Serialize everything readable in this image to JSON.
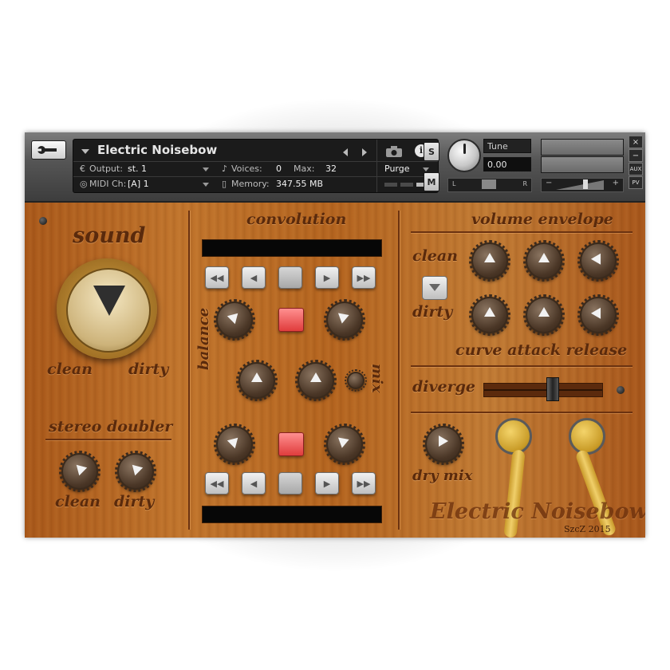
{
  "header": {
    "instrument_name": "Electric Noisebow",
    "output_label": "Output:",
    "output_value": "st. 1",
    "midi_label": "MIDI Ch:",
    "midi_value": "[A] 1",
    "voices_label": "Voices:",
    "voices_value": "0",
    "max_label": "Max:",
    "max_value": "32",
    "memory_label": "Memory:",
    "memory_value": "347.55 MB",
    "purge_label": "Purge",
    "solo_label": "S",
    "mute_label": "M",
    "tune_label": "Tune",
    "tune_value": "0.00",
    "pan_left": "L",
    "pan_right": "R",
    "vol_minus": "−",
    "vol_plus": "+",
    "side_close": "×",
    "side_min": "−",
    "side_aux": "AUX",
    "side_pv": "PV"
  },
  "panel": {
    "sound": {
      "title": "sound",
      "left": "clean",
      "right": "dirty"
    },
    "stereo_doubler": {
      "title": "stereo doubler",
      "left": "clean",
      "right": "dirty"
    },
    "convolution": {
      "title": "convolution",
      "balance": "balance",
      "mix": "mix"
    },
    "volume_envelope": {
      "title": "volume envelope",
      "row1": "clean",
      "row2": "dirty",
      "columns": "curve attack release"
    },
    "diverge_label": "diverge",
    "diverge_value": 0.6,
    "dry_mix_label": "dry mix",
    "brand": "Electric Noisebow",
    "credit": "SzcZ 2015"
  },
  "icons": {
    "wrench": "wrench-icon",
    "camera": "camera-icon",
    "info": "info-icon",
    "transport": [
      "rewind-icon",
      "previous-icon",
      "stop-icon",
      "next-icon",
      "fast-forward-icon"
    ]
  }
}
